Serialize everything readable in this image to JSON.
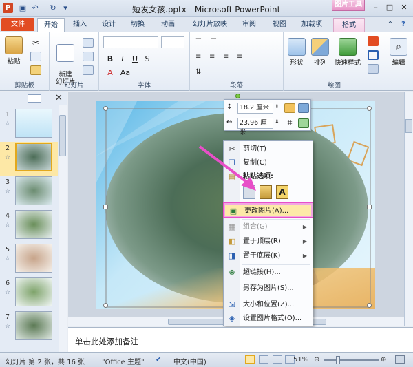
{
  "window": {
    "title": "短发女孩.pptx - Microsoft PowerPoint",
    "tools_tab": "图片工具"
  },
  "tabs": [
    "文件",
    "开始",
    "插入",
    "设计",
    "切换",
    "动画",
    "幻灯片放映",
    "审阅",
    "视图",
    "加载项",
    "格式"
  ],
  "ribbon": {
    "paste_label": "粘贴",
    "clipboard_label": "剪贴板",
    "new_slide_label": "新建\n幻灯片",
    "slides_label": "幻灯片",
    "font_label": "字体",
    "paragraph_label": "段落",
    "shape_label": "形状",
    "arrange_label": "排列",
    "quick_style_label": "快速样式",
    "drawing_label": "绘图",
    "edit_label": "编辑"
  },
  "thumbnails": {
    "numbers": [
      "1",
      "2",
      "3",
      "4",
      "5",
      "6",
      "7"
    ],
    "selected_index": 1
  },
  "size_bar": {
    "height": "18.2 厘米",
    "width": "23.96 厘米"
  },
  "context_menu": {
    "cut": "剪切(T)",
    "copy": "复制(C)",
    "paste_options": "粘贴选项:",
    "paste_icon_label": "A",
    "change_picture": "更改图片(A)...",
    "group": "组合(G)",
    "bring_front": "置于顶层(R)",
    "send_back": "置于底层(K)",
    "hyperlink": "超链接(H)...",
    "save_as_picture": "另存为图片(S)...",
    "size_position": "大小和位置(Z)...",
    "format_picture": "设置图片格式(O)..."
  },
  "notes": {
    "placeholder": "单击此处添加备注"
  },
  "status": {
    "slide_info": "幻灯片 第 2 张，共 16 张",
    "theme": "\"Office 主题\"",
    "language": "中文(中国)",
    "zoom": "51%"
  },
  "colors": {
    "file_tab": "#e24c22",
    "tools_tab": "#e793c6",
    "highlight_border": "#e84fc8",
    "selected_thumb": "#fde8a6"
  }
}
